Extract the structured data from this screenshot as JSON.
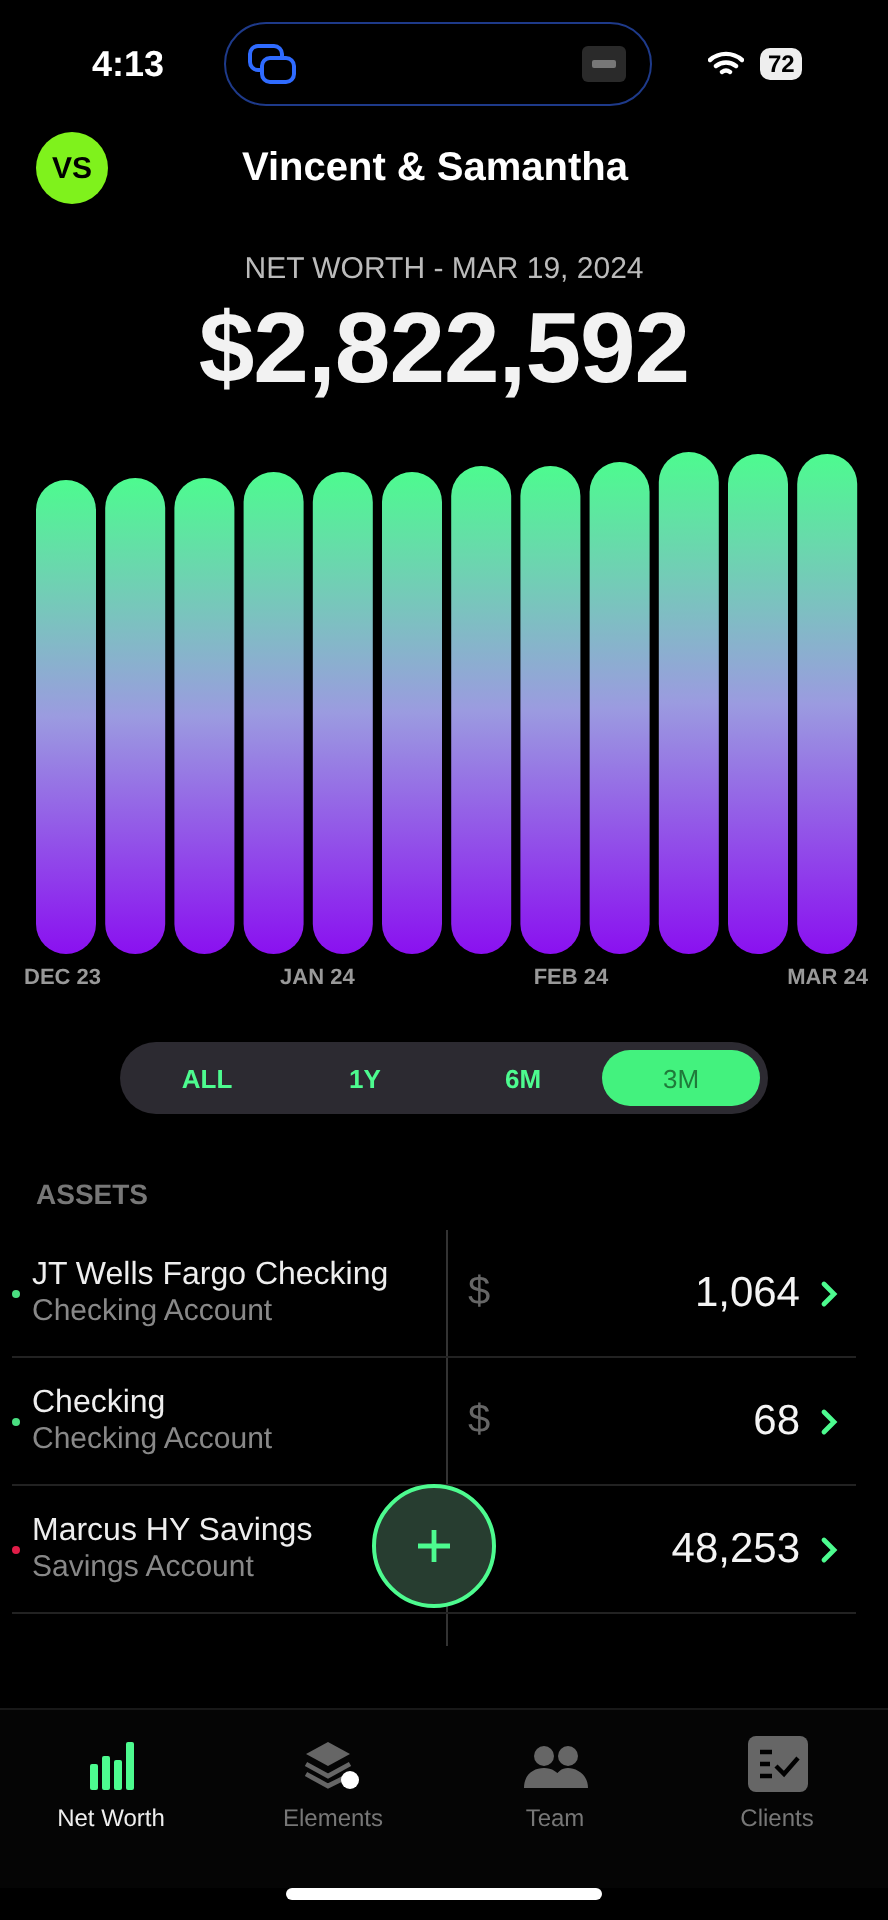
{
  "status_bar": {
    "time": "4:13",
    "battery": "72"
  },
  "header": {
    "avatar": "VS",
    "title": "Vincent & Samantha"
  },
  "net_worth": {
    "label": "NET WORTH - MAR 19, 2024",
    "amount": "$2,822,592"
  },
  "chart": {
    "axis_labels": [
      "DEC 23",
      "JAN 24",
      "FEB 24",
      "MAR 24"
    ]
  },
  "ranges": [
    {
      "label": "ALL",
      "selected": false
    },
    {
      "label": "1Y",
      "selected": false
    },
    {
      "label": "6M",
      "selected": false
    },
    {
      "label": "3M",
      "selected": true
    }
  ],
  "assets": {
    "heading": "ASSETS",
    "rows": [
      {
        "name": "JT Wells Fargo Checking",
        "type": "Checking Account",
        "currency": "$",
        "value": "1,064",
        "color": "#4ade80"
      },
      {
        "name": "Checking",
        "type": "Checking Account",
        "currency": "$",
        "value": "68",
        "color": "#4ade80"
      },
      {
        "name": "Marcus HY Savings",
        "type": "Savings Account",
        "value": "48,253",
        "color": "#e11d48"
      }
    ]
  },
  "tab_bar": [
    {
      "kind": "networth",
      "label": "Net Worth",
      "selected": true
    },
    {
      "kind": "elements",
      "label": "Elements",
      "selected": false
    },
    {
      "kind": "team",
      "label": "Team",
      "selected": false
    },
    {
      "kind": "clients",
      "label": "Clients",
      "selected": false
    }
  ]
}
